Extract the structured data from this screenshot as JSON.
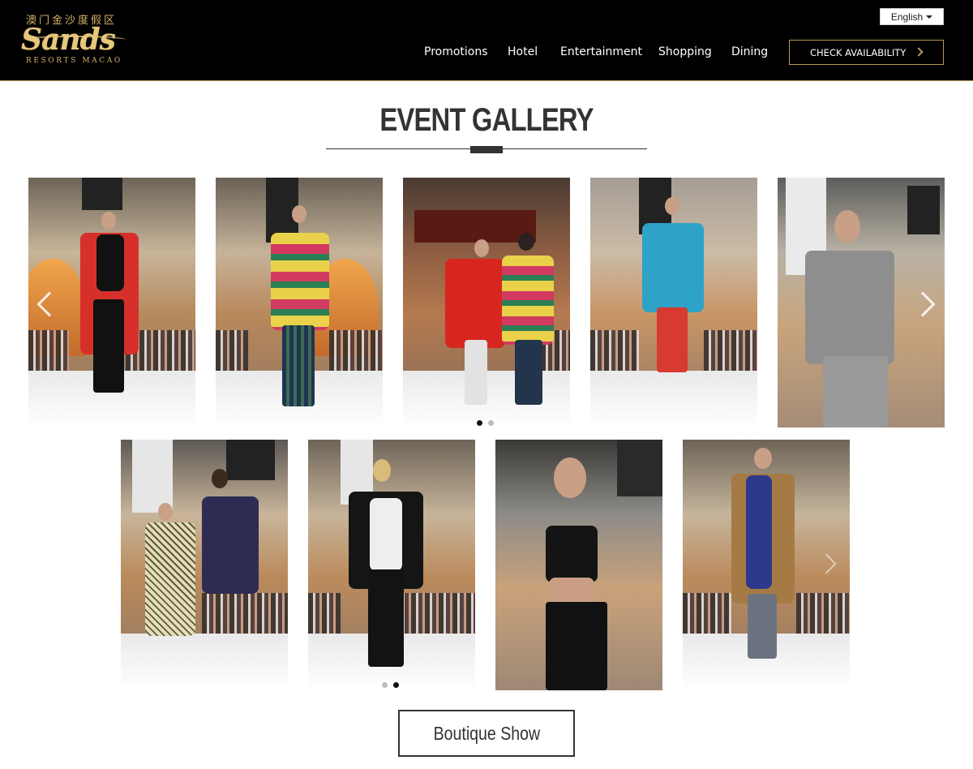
{
  "header": {
    "logo_cn": "澳门金沙度假区",
    "logo_main": "Sands",
    "logo_sub": "RESORTS MACAO",
    "language": "English",
    "nav": [
      {
        "label": "Promotions"
      },
      {
        "label": "Hotel"
      },
      {
        "label": "Entertainment"
      },
      {
        "label": "Shopping"
      },
      {
        "label": "Dining"
      }
    ],
    "cta": "CHECK AVAILABILITY"
  },
  "gallery": {
    "title": "EVENT GALLERY",
    "row1_dots": {
      "count": 2,
      "active": 1
    },
    "row2_dots": {
      "count": 2,
      "active": 2
    },
    "button": "Boutique Show"
  },
  "colors": {
    "header_bg": "#000000",
    "gold_accent": "#b89a5a",
    "title_text": "#333333"
  }
}
